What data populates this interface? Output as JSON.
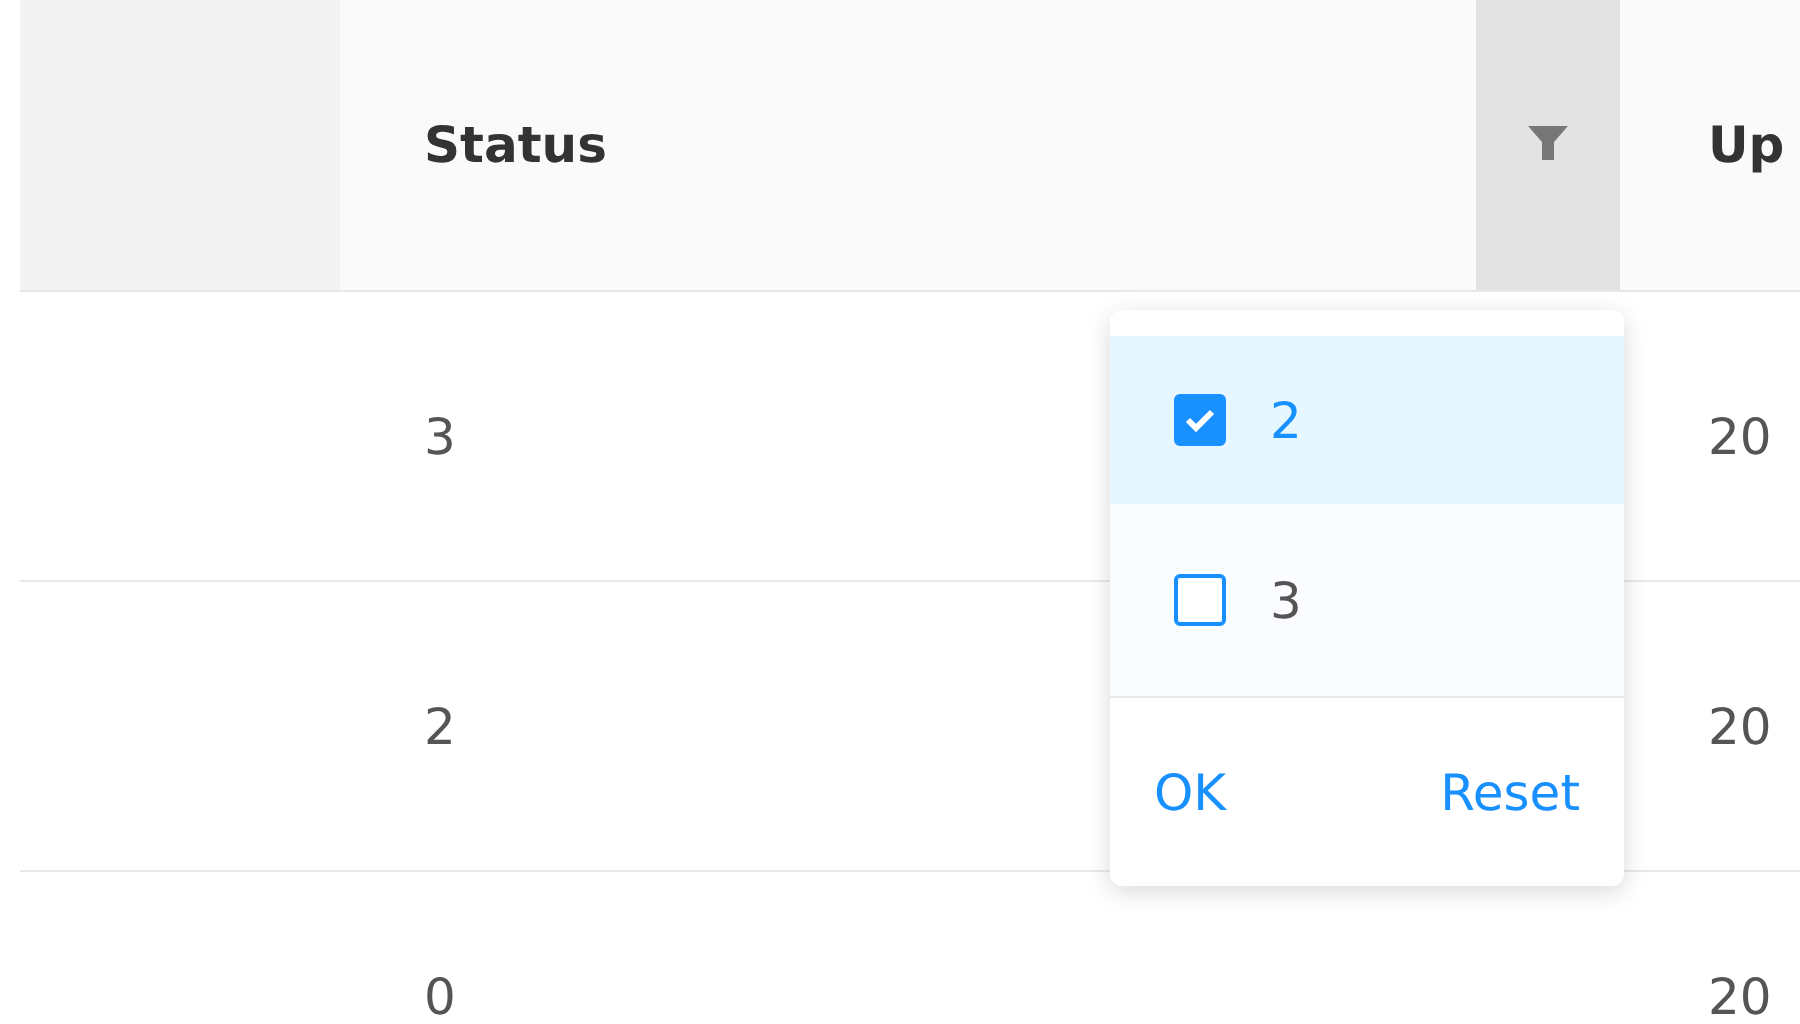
{
  "table": {
    "columns": [
      {
        "label": "Status",
        "filter": true
      },
      {
        "label": "Up"
      }
    ],
    "rows": [
      {
        "status": "3",
        "column_3": "20"
      },
      {
        "status": "2",
        "column_3": "20"
      },
      {
        "status": "0",
        "column_3": "20"
      }
    ]
  },
  "filter_dropdown": {
    "options": [
      {
        "label": "2",
        "checked": true
      },
      {
        "label": "3",
        "checked": false
      }
    ],
    "buttons": [
      "OK",
      "Reset"
    ]
  }
}
